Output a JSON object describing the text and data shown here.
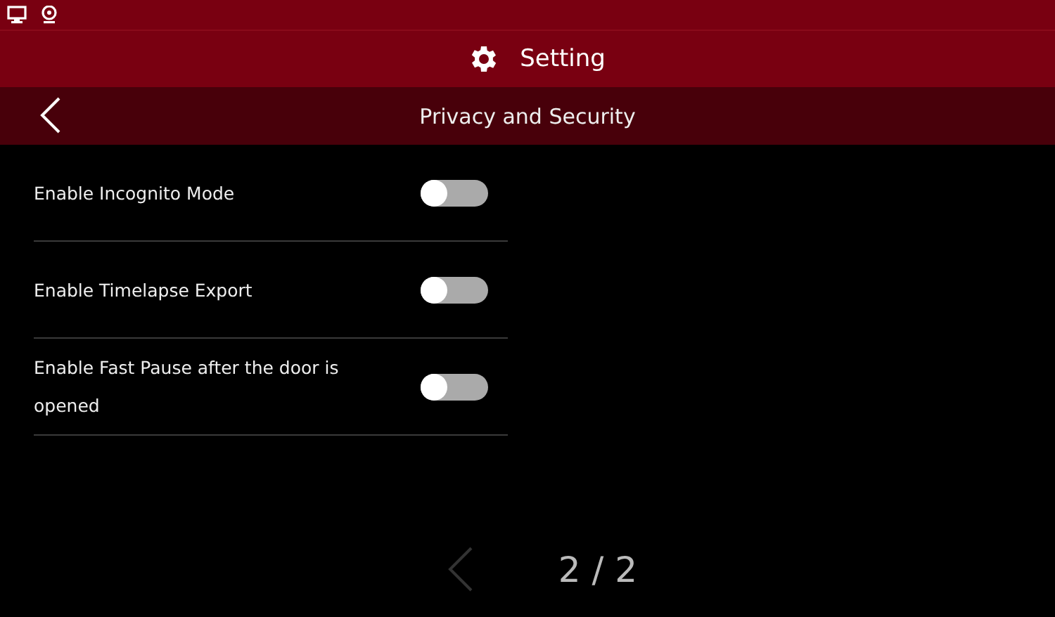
{
  "header": {
    "title": "Setting"
  },
  "subheader": {
    "title": "Privacy and Security"
  },
  "settings": [
    {
      "label": "Enable Incognito Mode",
      "on": false
    },
    {
      "label": "Enable Timelapse Export",
      "on": false
    },
    {
      "label": "Enable Fast Pause after the door is opened",
      "on": false
    }
  ],
  "pager": {
    "page": "2 / 2",
    "prev_disabled": true
  }
}
